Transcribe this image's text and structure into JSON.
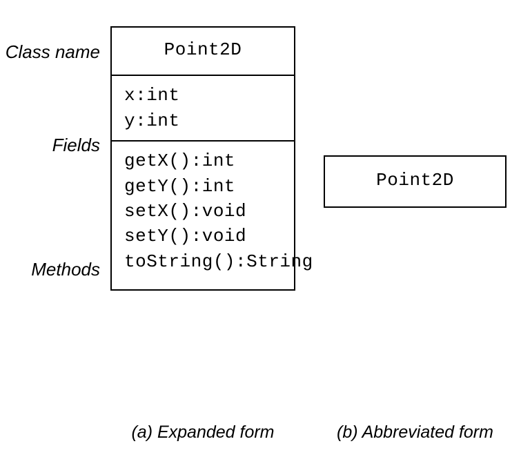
{
  "sideLabels": {
    "className": "Class name",
    "fields": "Fields",
    "methods": "Methods"
  },
  "expanded": {
    "name": "Point2D",
    "fields": [
      "x:int",
      "y:int"
    ],
    "methods": [
      "getX():int",
      "getY():int",
      "setX():void",
      "setY():void",
      "toString():String"
    ]
  },
  "abbreviated": {
    "name": "Point2D"
  },
  "captions": {
    "a": "(a) Expanded form",
    "b": "(b) Abbreviated form"
  }
}
